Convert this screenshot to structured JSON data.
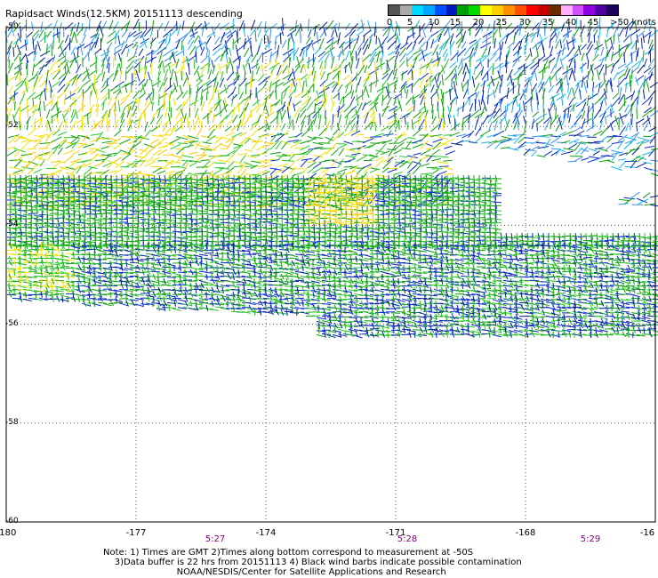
{
  "title": "Rapidsact Winds(12.5KM) 20151113 descending",
  "colorbar": {
    "colors": [
      "#555555",
      "#aaaaaa",
      "#00d8ff",
      "#00a8ff",
      "#0050ff",
      "#0018c0",
      "#00a000",
      "#00d800",
      "#ffff00",
      "#ffd000",
      "#ff9000",
      "#ff5000",
      "#ff0000",
      "#c80000",
      "#6a2b00",
      "#ffb0ff",
      "#d050ff",
      "#9000e0",
      "#5000a0",
      "#200060"
    ],
    "tick_labels": [
      "0",
      "5",
      "10",
      "15",
      "20",
      "25",
      "30",
      "35",
      "40",
      "45",
      ">50 knots"
    ]
  },
  "map": {
    "x_ticks": [
      "-180",
      "-177",
      "-174",
      "-171",
      "-168",
      "-16"
    ],
    "y_ticks": [
      "-50",
      "-52",
      "-54",
      "-56",
      "-58",
      "-60"
    ],
    "time_labels": [
      "5:27",
      "5:28",
      "5:29"
    ],
    "lon_range": [
      -180,
      -165
    ],
    "lat_range": [
      -60,
      -50
    ],
    "grid": "dotted"
  },
  "note": {
    "line1": "Note: 1) Times are GMT 2)Times along bottom correspond to measurement at -50S",
    "line2": "3)Data buffer is 22 hrs from 20151113 4) Black wind barbs indicate possible contamination",
    "line3": "NOAA/NESDIS/Center for Satellite Applications and Research"
  },
  "wind_colors": {
    "blue": "#0a2cd0",
    "navy": "#001c9a",
    "cyan": "#18b8f0",
    "sky": "#3c8ef0",
    "green": "#10a010",
    "lime": "#28c828",
    "yellow": "#f4e000",
    "gold": "#f6c800"
  }
}
